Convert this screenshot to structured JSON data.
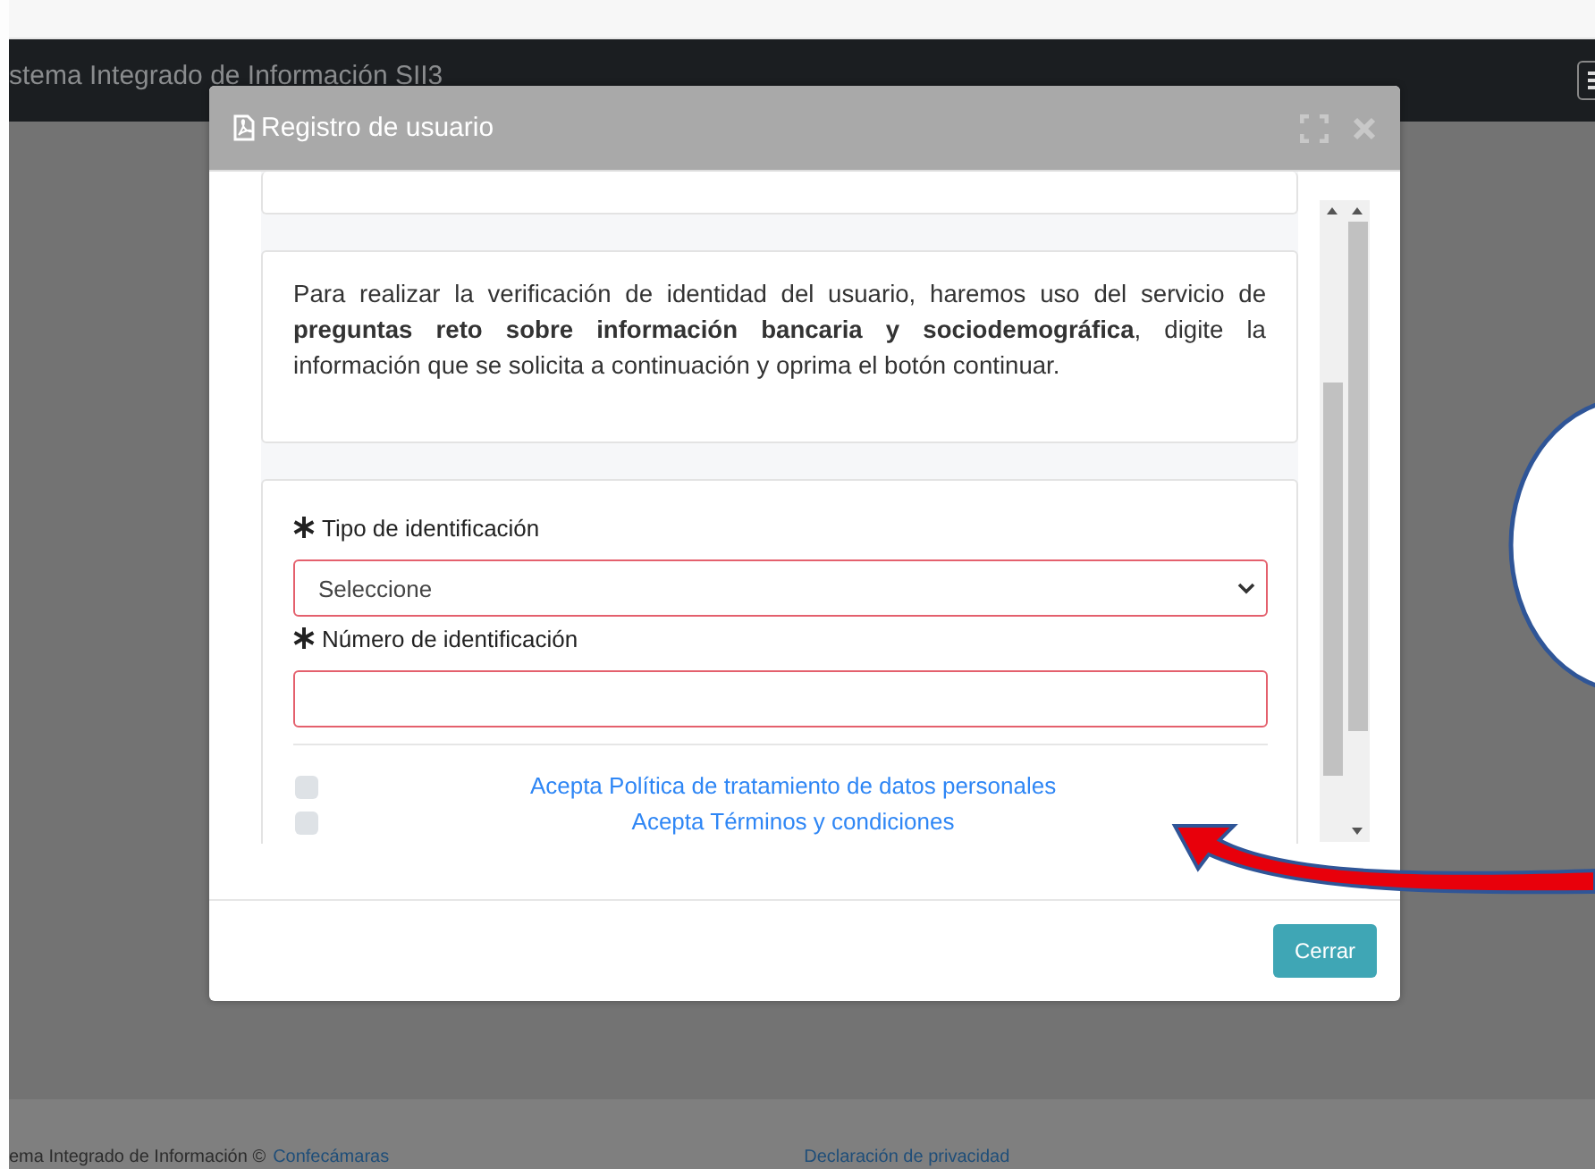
{
  "app": {
    "title": "stema Integrado de Información SII3"
  },
  "modal": {
    "title": "Registro de usuario",
    "intro": "Para realizar la verificación de identidad del usuario, haremos uso del servicio de **preguntas reto sobre información bancaria y sociodemográfica**, digite la información que se solicita a continuación y oprima el botón continuar.",
    "fields": [
      {
        "kind": "select",
        "label": "Tipo de identificación",
        "required": true,
        "invalid": true,
        "value": "Seleccione"
      },
      {
        "kind": "text",
        "label": "Número de identificación",
        "required": true,
        "invalid": true
      }
    ],
    "consents": [
      {
        "label": "Acepta Política de tratamiento de datos personales",
        "checked": false
      },
      {
        "label": "Acepta Términos y condiciones",
        "checked": false
      }
    ],
    "buttons": [
      "Cerrar"
    ]
  },
  "footer": {
    "text": "ema Integrado de Información ©",
    "link": "Confecámaras",
    "privacy": "Declaración de privacidad"
  }
}
